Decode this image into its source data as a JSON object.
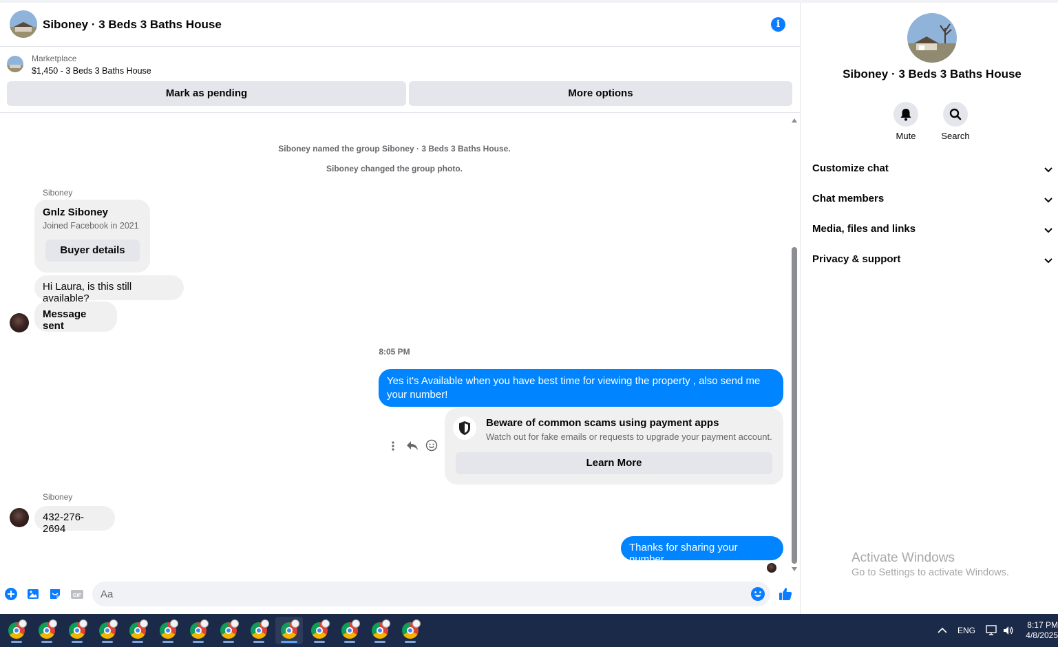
{
  "header": {
    "title": "Siboney · 3 Beds 3 Baths House",
    "info_icon": "info-icon"
  },
  "marketplace": {
    "label": "Marketplace",
    "item": "$1,450 - 3 Beds 3 Baths House",
    "mark_pending": "Mark as pending",
    "more_options": "More options"
  },
  "messages": {
    "system1": "Siboney named the group Siboney · 3 Beds 3 Baths House.",
    "system2": "Siboney changed the group photo.",
    "sender1": "Siboney",
    "card": {
      "name": "Gnlz Siboney",
      "subtitle": "Joined Facebook in 2021",
      "button": "Buyer details"
    },
    "in1": "Hi Laura, is this still available?",
    "in2": "Message sent",
    "time": "8:05 PM",
    "out1": "Yes it's Available when you have best time for viewing the property , also send me your number!",
    "scam": {
      "title": "Beware of common scams using payment apps",
      "subtitle": "Watch out for fake emails or requests to upgrade your payment account.",
      "button": "Learn More"
    },
    "sender2": "Siboney",
    "in3": "432-276-2694",
    "out2": "Thanks for sharing your number"
  },
  "composer": {
    "placeholder": "Aa"
  },
  "panel": {
    "title": "Siboney · 3 Beds 3 Baths House",
    "mute": "Mute",
    "search": "Search",
    "sections": [
      "Customize chat",
      "Chat members",
      "Media, files and links",
      "Privacy & support"
    ],
    "watermark_title": "Activate Windows",
    "watermark_sub": "Go to Settings to activate Windows."
  },
  "taskbar": {
    "apps_count_label": "14",
    "lang": "ENG",
    "time": "8:17 PM",
    "date": "4/8/2025"
  },
  "colors": {
    "accent": "#0084ff",
    "bubble_in": "#f0f0f0",
    "taskbar": "#1c2a4a"
  }
}
